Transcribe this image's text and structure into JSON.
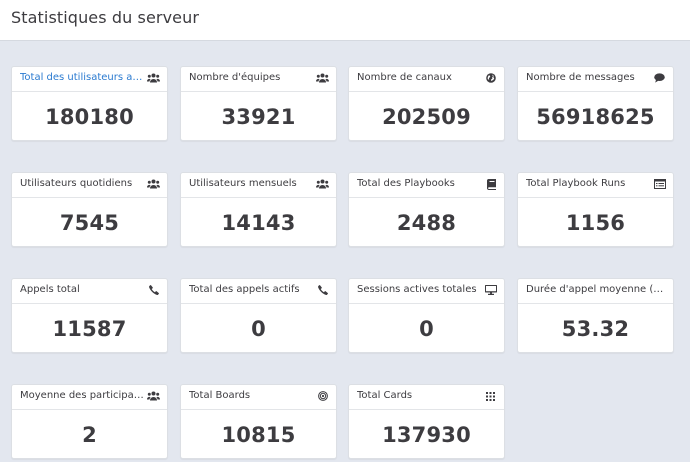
{
  "page": {
    "title": "Statistiques du serveur"
  },
  "cards": [
    {
      "title": "Total des utilisateurs activ…",
      "value": "180180",
      "icon": "users-icon"
    },
    {
      "title": "Nombre d'équipes",
      "value": "33921",
      "icon": "users-icon"
    },
    {
      "title": "Nombre de canaux",
      "value": "202509",
      "icon": "globe-icon"
    },
    {
      "title": "Nombre de messages",
      "value": "56918625",
      "icon": "comment-icon"
    },
    {
      "title": "Utilisateurs quotidiens",
      "value": "7545",
      "icon": "users-icon"
    },
    {
      "title": "Utilisateurs mensuels",
      "value": "14143",
      "icon": "users-icon"
    },
    {
      "title": "Total des Playbooks",
      "value": "2488",
      "icon": "book-icon"
    },
    {
      "title": "Total Playbook Runs",
      "value": "1156",
      "icon": "list-icon"
    },
    {
      "title": "Appels total",
      "value": "11587",
      "icon": "phone-icon"
    },
    {
      "title": "Total des appels actifs",
      "value": "0",
      "icon": "phone-icon"
    },
    {
      "title": "Sessions actives totales",
      "value": "0",
      "icon": "monitor-icon"
    },
    {
      "title": "Durée d'appel moyenne (…",
      "value": "53.32",
      "icon": ""
    },
    {
      "title": "Moyenne des participants …",
      "value": "2",
      "icon": "users-icon"
    },
    {
      "title": "Total Boards",
      "value": "10815",
      "icon": "target-icon"
    },
    {
      "title": "Total Cards",
      "value": "137930",
      "icon": "grid-icon"
    }
  ],
  "colors": {
    "link": "#2a7ad0",
    "text": "#3d3c40",
    "background": "#e3e7ef",
    "icon": "#3d3c40"
  }
}
